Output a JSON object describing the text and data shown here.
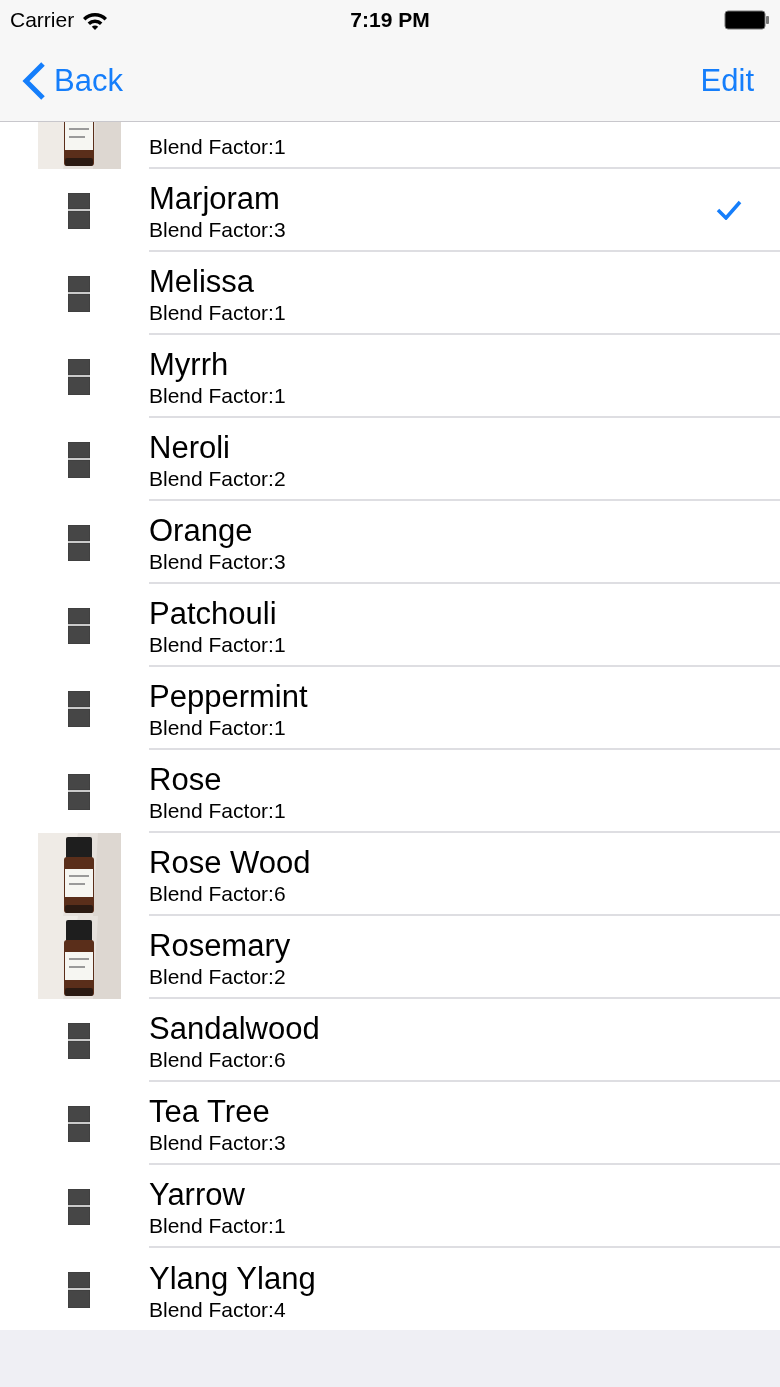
{
  "status_bar": {
    "carrier": "Carrier",
    "time": "7:19 PM"
  },
  "nav_bar": {
    "back": "Back",
    "edit": "Edit"
  },
  "rows": [
    {
      "detail": "Blend Factor:1",
      "checked": false
    },
    {
      "kind": "placeholder",
      "name": "Marjoram",
      "detail": "Blend Factor:3",
      "checked": true
    },
    {
      "kind": "placeholder",
      "name": "Melissa",
      "detail": "Blend Factor:1",
      "checked": false
    },
    {
      "kind": "placeholder",
      "name": "Myrrh",
      "detail": "Blend Factor:1",
      "checked": false
    },
    {
      "kind": "placeholder",
      "name": "Neroli",
      "detail": "Blend Factor:2",
      "checked": false
    },
    {
      "kind": "placeholder",
      "name": "Orange",
      "detail": "Blend Factor:3",
      "checked": false
    },
    {
      "kind": "placeholder",
      "name": "Patchouli",
      "detail": "Blend Factor:1",
      "checked": false
    },
    {
      "kind": "placeholder",
      "name": "Peppermint",
      "detail": "Blend Factor:1",
      "checked": false
    },
    {
      "kind": "placeholder",
      "name": "Rose",
      "detail": "Blend Factor:1",
      "checked": false
    },
    {
      "name": "Rose Wood",
      "detail": "Blend Factor:6",
      "checked": false
    },
    {
      "name": "Rosemary",
      "detail": "Blend Factor:2",
      "checked": false
    },
    {
      "kind": "placeholder",
      "name": "Sandalwood",
      "detail": "Blend Factor:6",
      "checked": false
    },
    {
      "kind": "placeholder",
      "name": "Tea Tree",
      "detail": "Blend Factor:3",
      "checked": false
    },
    {
      "kind": "placeholder",
      "name": "Yarrow",
      "detail": "Blend Factor:1",
      "checked": false
    },
    {
      "kind": "placeholder",
      "name": "Ylang Ylang",
      "detail": "Blend Factor:4",
      "checked": false
    }
  ]
}
